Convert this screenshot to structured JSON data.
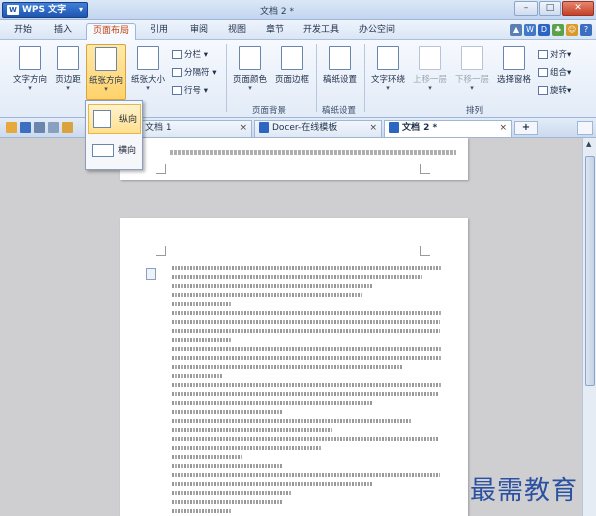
{
  "app": {
    "name": "WPS 文字",
    "doc_title": "文档 2 *"
  },
  "window_controls": {
    "minimize": "–",
    "maximize": "□",
    "close": "✕"
  },
  "menu": {
    "tabs": [
      "开始",
      "插入",
      "页面布局",
      "引用",
      "审阅",
      "视图",
      "章节",
      "开发工具",
      "办公空间"
    ],
    "active": "页面布局"
  },
  "ribbon": {
    "text_direction": "文字方向",
    "margins": "页边距",
    "orientation": "纸张方向",
    "paper_size": "纸张大小",
    "columns": "分栏",
    "separator": "分隔符",
    "line_numbers": "行号",
    "page_color": "页面颜色",
    "page_border": "页面边框",
    "manuscript": "稿纸设置",
    "wrap_text": "文字环绕",
    "bring_forward": "上移一层",
    "send_backward": "下移一层",
    "selection_pane": "选择窗格",
    "align": "对齐",
    "group": "组合",
    "rotate": "旋转",
    "group_labels": {
      "background": "页面背景",
      "manuscript": "稿纸设置",
      "arrange": "排列"
    },
    "dropdown_arrow": "▾"
  },
  "tabs": [
    {
      "label": "文档 1",
      "close": "×"
    },
    {
      "label": "Docer-在线模板",
      "close": "×"
    },
    {
      "label": "文档 2 *",
      "close": "×"
    }
  ],
  "tab_add": "+",
  "orientation_menu": {
    "items": [
      "纵向",
      "横向"
    ],
    "highlighted": "纵向"
  },
  "watermark": "最需教育",
  "colors": {
    "accent": "#1f56b0",
    "active_tab_text": "#c04010",
    "highlight": "#ffd26b"
  }
}
